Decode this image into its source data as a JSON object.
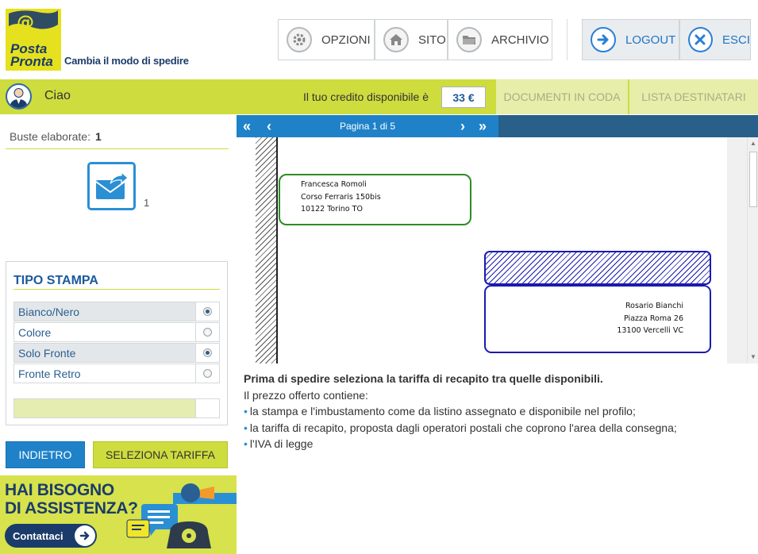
{
  "brand": {
    "logo_line1": "Posta",
    "logo_line2": "Pronta",
    "tagline": "Cambia il modo di spedire"
  },
  "topnav": {
    "opzioni": "OPZIONI",
    "sito": "SITO",
    "archivio": "ARCHIVIO",
    "logout": "LOGOUT",
    "esci": "ESCI"
  },
  "userbar": {
    "greeting": "Ciao",
    "credit_label": "Il tuo credito disponibile è",
    "credit_value": "33 €",
    "tab_documents": "DOCUMENTI IN CODA",
    "tab_recipients": "LISTA DESTINATARI"
  },
  "left": {
    "buste_label": "Buste elaborate:",
    "buste_count": "1",
    "envelope_count": "1",
    "tipo_title": "TIPO STAMPA",
    "options": [
      {
        "label": "Bianco/Nero",
        "selected": true
      },
      {
        "label": "Colore",
        "selected": false
      },
      {
        "label": "Solo Fronte",
        "selected": true
      },
      {
        "label": "Fronte Retro",
        "selected": false
      }
    ],
    "back_button": "INDIETRO",
    "select_button": "SELEZIONA TARIFFA"
  },
  "banner": {
    "line1": "HAI BISOGNO",
    "line2": "DI ASSISTENZA?",
    "cta": "Contattaci"
  },
  "pager": {
    "label": "Pagina 1 di 5"
  },
  "preview": {
    "sender": [
      "Francesca Romoli",
      "Corso Ferraris 150bis",
      "10122 Torino TO"
    ],
    "recipient": [
      "Rosario Bianchi",
      "Piazza Roma 26",
      "13100 Vercelli VC"
    ]
  },
  "info": {
    "lead": "Prima di spedire seleziona la tariffa di recapito tra quelle disponibili.",
    "intro": "Il prezzo offerto contiene:",
    "bullets": [
      "la stampa e l'imbustamento come da listino assegnato e disponibile nel profilo;",
      "la tariffa di recapito, proposta dagli operatori postali che coprono l'area della consegna;",
      "l'IVA di legge"
    ]
  },
  "colors": {
    "accent_green": "#cedc3e",
    "accent_blue": "#1f82c8",
    "navy": "#1b3c6a"
  }
}
